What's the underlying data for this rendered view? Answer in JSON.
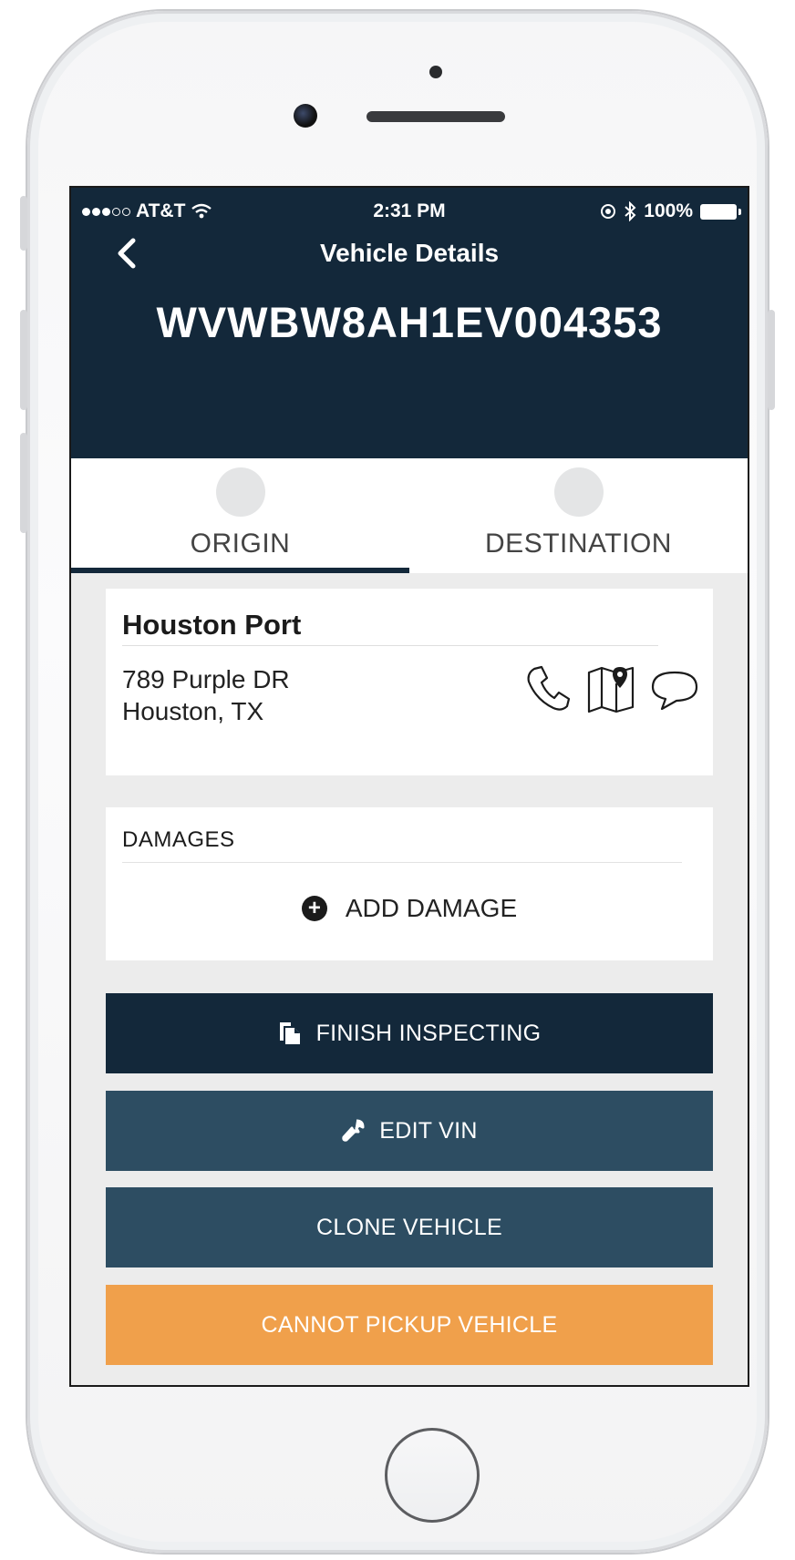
{
  "status_bar": {
    "carrier": "AT&T",
    "time": "2:31 PM",
    "battery": "100%"
  },
  "header": {
    "title": "Vehicle Details",
    "vin": "WVWBW8AH1EV004353"
  },
  "tabs": {
    "origin": "ORIGIN",
    "destination": "DESTINATION"
  },
  "location": {
    "name": "Houston Port",
    "address_line1": "789 Purple DR",
    "address_line2": "Houston, TX"
  },
  "damages": {
    "title": "DAMAGES",
    "add_label": "ADD DAMAGE"
  },
  "actions": {
    "finish_inspecting": "FINISH INSPECTING",
    "edit_vin": "EDIT VIN",
    "clone_vehicle": "CLONE VEHICLE",
    "cannot_pickup": "CANNOT PICKUP VEHICLE"
  },
  "colors": {
    "header_bg": "#13283a",
    "secondary_button": "#2d4d62",
    "warning_button": "#f0a04b",
    "content_bg": "#ececec"
  },
  "icons": [
    "back-chevron-icon",
    "wifi-icon",
    "location-lock-icon",
    "bluetooth-icon",
    "battery-icon",
    "phone-icon",
    "map-pin-icon",
    "chat-bubble-icon",
    "add-circle-icon",
    "copy-document-icon",
    "wrench-icon"
  ]
}
